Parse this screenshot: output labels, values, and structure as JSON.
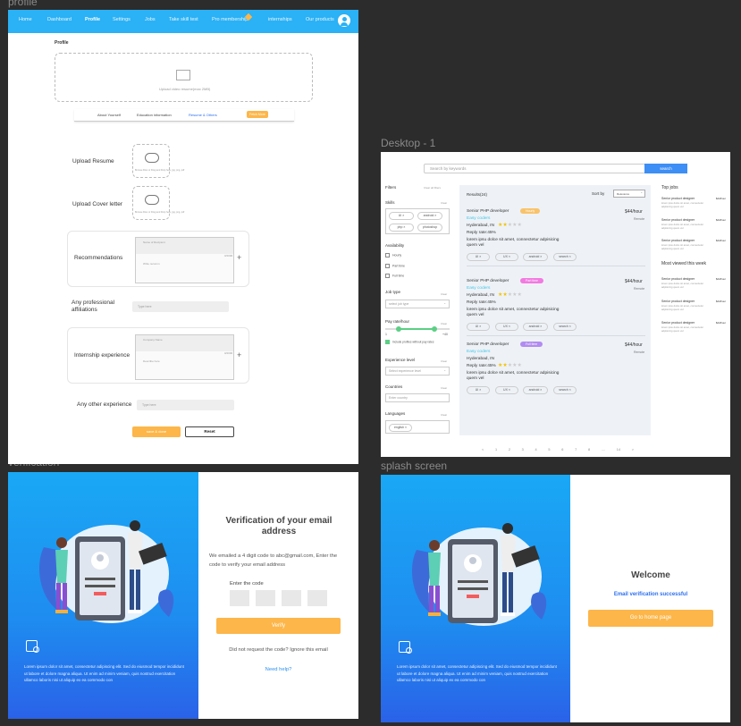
{
  "frames": {
    "profile": "profile",
    "desktop": "Desktop - 1",
    "verification": "verification",
    "splash": "splash screen"
  },
  "profile": {
    "nav": [
      "Home",
      "Dashboard",
      "Profile",
      "Settings",
      "Jobs",
      "Take skill test",
      "Pro membership",
      "internships",
      "Our products"
    ],
    "title": "Profile",
    "upload_hint": "Upload video resume(max 2MB)",
    "tabs": [
      "About Yourself",
      "Education information",
      "Resume & Others",
      "Fetch More"
    ],
    "resume": "Upload Resume",
    "cover": "Upload Cover letter",
    "upload_tiny": "Browse Files or Drag and Drop here, jpg, png, pdf",
    "recommendations": "Recommendations",
    "rec_name": "Name of Recipient",
    "rec_count": "0/2000",
    "rec_text": "Write recomm",
    "affiliations": "Any professional affiliations",
    "type_here": "Type here",
    "internship": "Internship experience",
    "int_field1": "Company Name",
    "int_count": "0/2000",
    "int_field2": "Describe here",
    "other": "Any other experience",
    "save": "save & done",
    "reset": "Reset"
  },
  "desktop": {
    "search_placeholder": "Search by keywords",
    "search_btn": "search",
    "filters": "Filters",
    "clear_all": "Clear all filters",
    "skills": "Skills",
    "clear": "Clear",
    "skill_tags": [
      "UI",
      "android",
      "php",
      "photoshop"
    ],
    "availability": "Availability",
    "avail": [
      "Hourly",
      "Part time",
      "Full time"
    ],
    "job_type": "Job type",
    "select_job": "select job type",
    "pay": "Pay rate/hour",
    "pay_min": "1",
    "pay_max": "+40",
    "include": "Include profiles without pay rates",
    "exp": "Experience level",
    "select_exp": "Select experience level",
    "countries": "Countries",
    "enter_country": "Enter country",
    "languages": "Languages",
    "lang_tag": "english",
    "results": "Results(24)",
    "sort": "Sort by",
    "relevance": "Relevance",
    "jobs": [
      {
        "title": "Senior PHP developer",
        "tag": "Hourly",
        "tag_color": "#f9c36a",
        "company": "Easy coders",
        "rate": "$44/hour",
        "loc": "Hyderabad, IN",
        "mode": "Remote",
        "reply": "Reply rate:45%",
        "desc": "lorem ipsu dolce sit amet, connectetur adpisicing quem vel",
        "pills": [
          "UI",
          "UX",
          "android",
          "search"
        ]
      },
      {
        "title": "Senior PHP developer",
        "tag": "Part time",
        "tag_color": "#f27ae0",
        "company": "Easy coders",
        "rate": "$44/hour",
        "loc": "Hyderabad, IN",
        "mode": "Remote",
        "reply": "Reply rate:45%",
        "desc": "lorem ipsu dolce sit amet, connectetur adpisicing quem vel",
        "pills": [
          "UI",
          "UX",
          "android",
          "search"
        ]
      },
      {
        "title": "Senior PHP developer",
        "tag": "Full time",
        "tag_color": "#b28cf0",
        "company": "Easy coders",
        "rate": "$44/hour",
        "loc": "Hyderabad, IN",
        "mode": "Remote",
        "reply": "Reply rate:45%",
        "desc": "lorem ipsu dolce sit amet, connectetur adpisicing quem vel",
        "pills": [
          "UI",
          "UX",
          "android",
          "search"
        ]
      }
    ],
    "pages": [
      "<",
      "1",
      "2",
      "3",
      "4",
      "5",
      "6",
      "7",
      "8",
      "....",
      "14",
      ">"
    ],
    "top_jobs": "Top jobs",
    "most_viewed": "Most viewed this week",
    "side_job": "Senior product designer",
    "side_rate": "$44/hour",
    "side_desc": "lorem ipsu dolce sit amet, connectetur adpisicing quem vel"
  },
  "verify": {
    "title": "Verification of your email address",
    "text": "We emailed a 4 digit code to abc@gmail.com, Enter the code to verify your email address",
    "enter": "Enter the code",
    "btn": "Verify",
    "resend": "Did not request the code? Ignore this email",
    "help": "Need help?",
    "lorem": "Lorem ipsum dolor sit amet, consectetur adipiscing elit. Sed do eiusmod tempor incididunt ut labore et dolore magna aliqua. Ut enim ad minim veniam, quis nostrud exercitation ullamco laboris nisi ut aliquip ex ea commodo con"
  },
  "splash": {
    "welcome": "Welcome",
    "success": "Email verification successful",
    "btn": "Go to home page",
    "lorem": "Lorem ipsum dolor sit amet, consectetur adipiscing elit. Sed do eiusmod tempor incididunt ut labore et dolore magna aliqua. Ut enim ad minim veniam, quis nostrud exercitation ullamco laboris nisi ut aliquip ex ea commodo con"
  },
  "colors": {
    "accent": "#2bb1f5",
    "orange": "#fdb64a",
    "blue_grad": "#1e8cf0"
  }
}
